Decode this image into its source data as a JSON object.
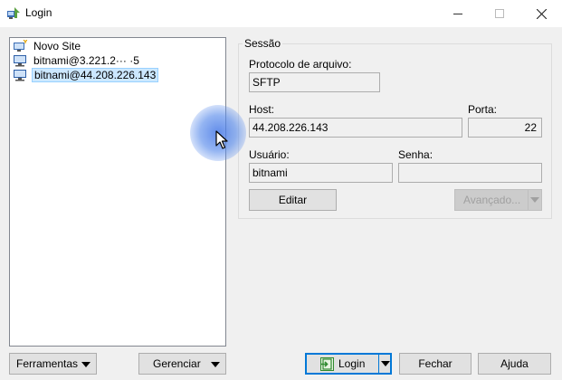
{
  "window": {
    "title": "Login"
  },
  "site_tree": {
    "items": [
      {
        "label": "Novo Site",
        "icon": "new-site-icon",
        "selected": false
      },
      {
        "label": "bitnami@3.221.2··· ·5",
        "icon": "computer-icon",
        "selected": false
      },
      {
        "label": "bitnami@44.208.226.143",
        "icon": "computer-icon",
        "selected": true
      }
    ]
  },
  "session": {
    "legend": "Sessão",
    "protocol_label": "Protocolo de arquivo:",
    "protocol_value": "SFTP",
    "host_label": "Host:",
    "host_value": "44.208.226.143",
    "port_label": "Porta:",
    "port_value": "22",
    "user_label": "Usuário:",
    "user_value": "bitnami",
    "password_label": "Senha:",
    "password_value": "",
    "edit_label": "Editar",
    "advanced_label": "Avançado..."
  },
  "footer": {
    "tools_label": "Ferramentas",
    "manage_label": "Gerenciar",
    "login_label": "Login",
    "close_label": "Fechar",
    "help_label": "Ajuda"
  },
  "colors": {
    "selection": "#cce8ff",
    "accent": "#0078d7",
    "cursor_highlight": "#4a7de6"
  }
}
